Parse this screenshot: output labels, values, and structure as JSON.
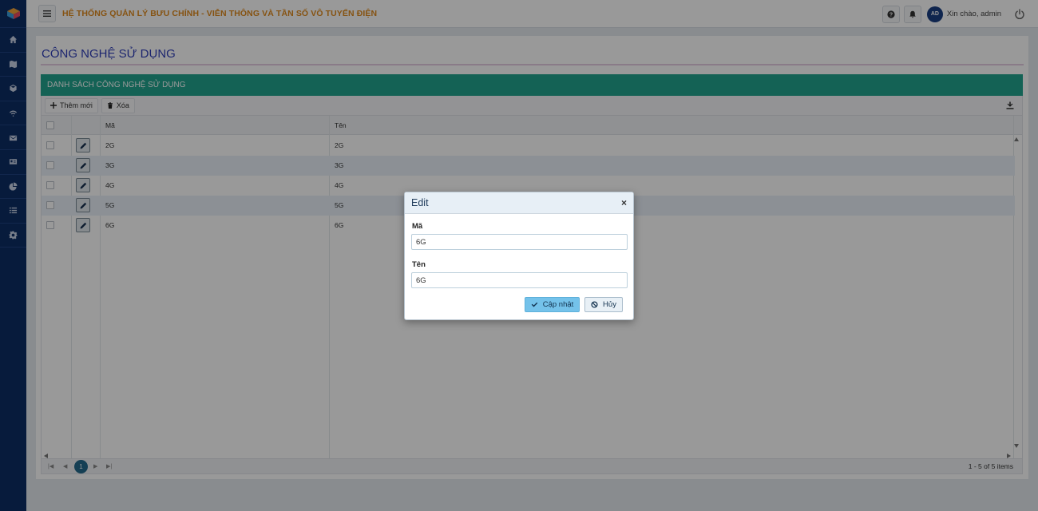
{
  "app": {
    "title": "HỆ THỐNG QUẢN LÝ BƯU CHÍNH - VIỄN THÔNG VÀ TẦN SỐ VÔ TUYẾN ĐIỆN",
    "user_initials": "AD",
    "greeting": "Xin chào, admin"
  },
  "sidebar": {
    "items": [
      {
        "icon": "home-icon"
      },
      {
        "icon": "map-icon"
      },
      {
        "icon": "cube-icon"
      },
      {
        "icon": "wifi-icon"
      },
      {
        "icon": "mail-icon"
      },
      {
        "icon": "id-card-icon"
      },
      {
        "icon": "pie-chart-icon"
      },
      {
        "icon": "list-icon"
      },
      {
        "icon": "gear-icon"
      }
    ]
  },
  "page": {
    "title": "CÔNG NGHỆ SỬ DỤNG",
    "panel_title": "DANH SÁCH CÔNG NGHỆ SỬ DỤNG"
  },
  "toolbar": {
    "add_label": "Thêm mới",
    "delete_label": "Xóa"
  },
  "grid": {
    "columns": [
      "Mã",
      "Tên"
    ],
    "rows": [
      {
        "ma": "2G",
        "ten": "2G"
      },
      {
        "ma": "3G",
        "ten": "3G"
      },
      {
        "ma": "4G",
        "ten": "4G"
      },
      {
        "ma": "5G",
        "ten": "5G"
      },
      {
        "ma": "6G",
        "ten": "6G"
      }
    ]
  },
  "pager": {
    "current_page": "1",
    "info": "1 - 5 of 5 items"
  },
  "modal": {
    "title": "Edit",
    "close": "×",
    "ma_label": "Mã",
    "ma_value": "6G",
    "ten_label": "Tên",
    "ten_value": "6G",
    "update_label": "Cập nhật",
    "cancel_label": "Hủy"
  },
  "colors": {
    "sidebar": "#0d2d64",
    "title_orange": "#e08a1e",
    "panel_teal": "#22a48e",
    "page_title_blue": "#2f3fb9",
    "update_button": "#74c2ea"
  }
}
